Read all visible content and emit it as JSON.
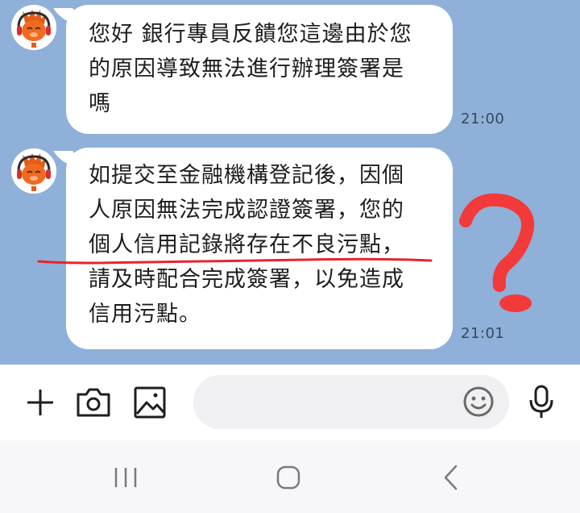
{
  "messages": [
    {
      "lines": [
        "您好 銀行專員反饋您這邊由於您",
        "的原因導致無法進行辦理簽署是",
        "嗎"
      ],
      "time": "21:00"
    },
    {
      "lines": [
        "如提交至金融機構登記後，因個",
        "人原因無法完成認證簽署，您的",
        "個人信用記錄將存在不良污點，",
        "請及時配合完成簽署，以免造成",
        "信用污點。"
      ],
      "time": "21:01"
    }
  ],
  "input": {
    "placeholder": ""
  },
  "icons": {
    "add": "plus-icon",
    "camera": "camera-icon",
    "gallery": "image-icon",
    "emoji": "emoji-icon",
    "mic": "microphone-icon",
    "nav_recent": "recent-apps-icon",
    "nav_home": "home-icon",
    "nav_back": "back-icon"
  },
  "colors": {
    "chat_background": "#8fb0d8",
    "bubble": "#ffffff",
    "annotation_red": "#e8232f",
    "avatar_orange": "#f06b1f"
  }
}
